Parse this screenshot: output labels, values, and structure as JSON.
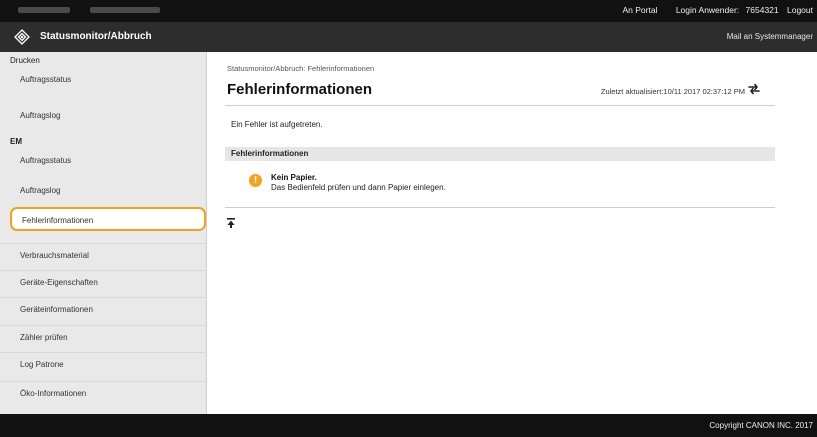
{
  "topbar": {
    "portal_link": "An Portal",
    "login_label": "Login Anwender:",
    "user_id": "7654321",
    "logout_link": "Logout"
  },
  "header": {
    "title": "Statusmonitor/Abbruch",
    "mail_link": "Mail an Systemmanager"
  },
  "sidebar": {
    "printing_heading": "Drucken",
    "printing_items": [
      {
        "label": "Auftragsstatus"
      },
      {
        "label": "Auftragslog"
      }
    ],
    "rx_heading": "EM",
    "rx_items": [
      {
        "label": "Auftragsstatus"
      },
      {
        "label": "Auftragslog"
      }
    ],
    "other_items": [
      {
        "label": "Fehlerinformationen"
      },
      {
        "label": "Verbrauchsmaterial"
      },
      {
        "label": "Geräte-Eigenschaften"
      },
      {
        "label": "Geräteinformationen"
      },
      {
        "label": "Zähler prüfen"
      },
      {
        "label": "Log Patrone"
      },
      {
        "label": "Öko-Informationen"
      }
    ]
  },
  "main": {
    "breadcrumb": "Statusmonitor/Abbruch: Fehlerinformationen",
    "title": "Fehlerinformationen",
    "last_updated": "Zuletzt aktualisiert:10/11 2017 02:37:12 PM",
    "message": "Ein Fehler ist aufgetreten.",
    "section_title": "Fehlerinformationen",
    "error": {
      "title": "Kein Papier.",
      "description": "Das Bedienfeld prüfen und dann Papier einlegen."
    }
  },
  "footer": {
    "copyright": "Copyright CANON INC. 2017"
  },
  "colors": {
    "topbar": "#111111",
    "titlebar": "#2d2d2d",
    "sidebar": "#e9e9e9",
    "highlight_outline": "#f3a21a",
    "warning": "#f5a31a"
  },
  "icons": {
    "logo": "canon-logo-icon",
    "refresh": "refresh-icon",
    "warning": "warning-icon",
    "back_to_top": "back-to-top-icon"
  }
}
